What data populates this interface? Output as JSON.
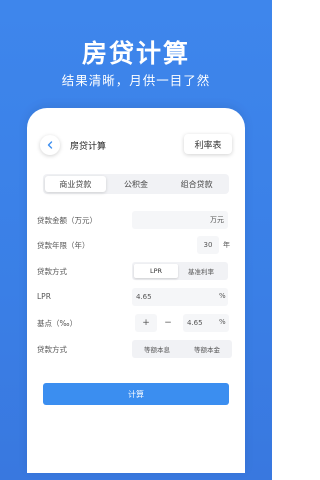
{
  "hero": {
    "title": "房贷计算",
    "subtitle": "结果清晰，月供一目了然"
  },
  "nav": {
    "title": "房贷计算",
    "rate_table": "利率表"
  },
  "tabs": [
    "商业贷款",
    "公积金",
    "组合贷款"
  ],
  "form": {
    "amount": {
      "label": "贷款金额（万元）",
      "unit": "万元"
    },
    "years": {
      "label": "贷款年限（年）",
      "value": "30",
      "unit": "年"
    },
    "rate_type": {
      "label": "贷款方式",
      "options": [
        "LPR",
        "基准利率"
      ]
    },
    "lpr": {
      "label": "LPR",
      "value": "4.65",
      "unit": "%"
    },
    "basis": {
      "label": "基点（‰）",
      "plus": "+",
      "minus": "−",
      "value": "4.65",
      "unit": "%"
    },
    "repay_type": {
      "label": "贷款方式",
      "options": [
        "等额本息",
        "等额本金"
      ]
    }
  },
  "calc_button": "计算",
  "colors": {
    "primary": "#3b8ef0",
    "hero": "#3e86ec"
  }
}
